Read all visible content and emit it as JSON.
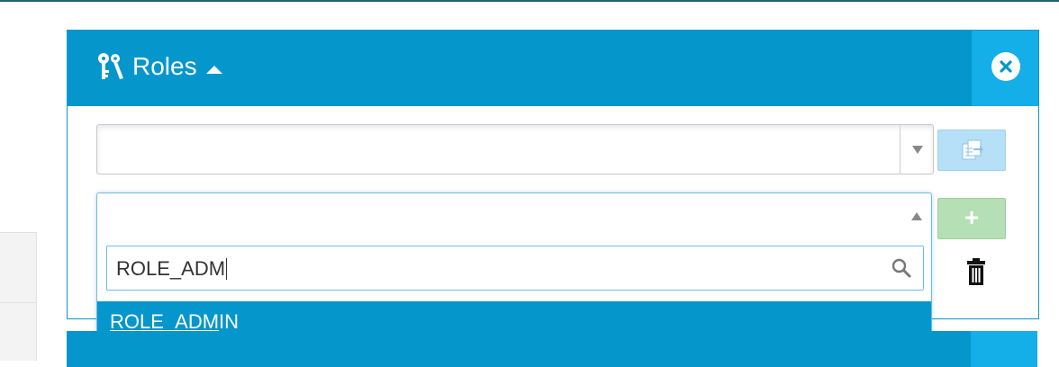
{
  "panel": {
    "title": "Roles",
    "icon": "keys-icon",
    "close_icon": "close-icon"
  },
  "role_select": {
    "value": "",
    "arrow": "chevron-down-icon"
  },
  "copy_button": {
    "icon": "copy-icon",
    "color": "#b6e0f7"
  },
  "new_role_select": {
    "value": "",
    "open": true
  },
  "search": {
    "value": "ROLE_ADM",
    "icon": "search-icon"
  },
  "options": [
    {
      "match": "ROLE_ADM",
      "rest": "IN"
    }
  ],
  "add_button": {
    "label": "+",
    "color": "#b5dfb5"
  },
  "delete_icon": "trash-icon",
  "colors": {
    "header": "#0596cc",
    "header_accent": "#14aee9",
    "highlight": "#0596cc"
  }
}
